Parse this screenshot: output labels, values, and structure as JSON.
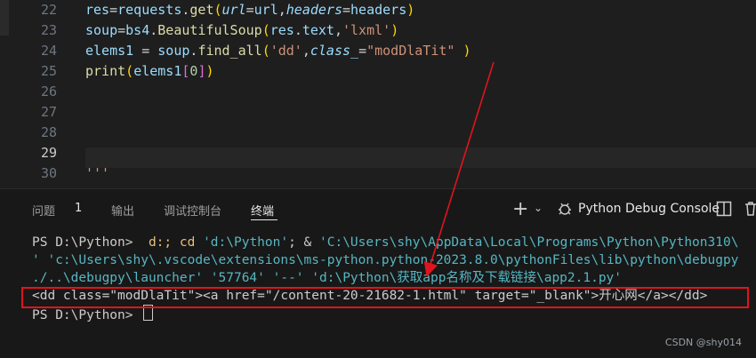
{
  "editor": {
    "lines": [
      {
        "num": "22",
        "tokens": [
          [
            "v",
            "res"
          ],
          [
            "p",
            "="
          ],
          [
            "v",
            "requests"
          ],
          [
            "p",
            "."
          ],
          [
            "f",
            "get"
          ],
          [
            "y",
            "("
          ],
          [
            "i",
            "url"
          ],
          [
            "p",
            "="
          ],
          [
            "v",
            "url"
          ],
          [
            "p",
            ","
          ],
          [
            "i",
            "headers"
          ],
          [
            "p",
            "="
          ],
          [
            "v",
            "headers"
          ],
          [
            "y",
            ")"
          ]
        ]
      },
      {
        "num": "23",
        "tokens": [
          [
            "v",
            "soup"
          ],
          [
            "p",
            "="
          ],
          [
            "v",
            "bs4"
          ],
          [
            "p",
            "."
          ],
          [
            "f",
            "BeautifulSoup"
          ],
          [
            "y",
            "("
          ],
          [
            "v",
            "res"
          ],
          [
            "p",
            "."
          ],
          [
            "v",
            "text"
          ],
          [
            "p",
            ","
          ],
          [
            "s",
            "'lxml'"
          ],
          [
            "y",
            ")"
          ]
        ]
      },
      {
        "num": "24",
        "tokens": [
          [
            "v",
            "elems1"
          ],
          [
            "p",
            " = "
          ],
          [
            "v",
            "soup"
          ],
          [
            "p",
            "."
          ],
          [
            "f",
            "find_all"
          ],
          [
            "y",
            "("
          ],
          [
            "s",
            "'dd'"
          ],
          [
            "p",
            ","
          ],
          [
            "i",
            "class_"
          ],
          [
            "p",
            "="
          ],
          [
            "s",
            "\"modDlaTit\""
          ],
          [
            "p",
            " "
          ],
          [
            "y",
            ")"
          ]
        ]
      },
      {
        "num": "25",
        "tokens": [
          [
            "f",
            "print"
          ],
          [
            "y",
            "("
          ],
          [
            "v",
            "elems1"
          ],
          [
            "m",
            "["
          ],
          [
            "n",
            "0"
          ],
          [
            "m",
            "]"
          ],
          [
            "y",
            ")"
          ]
        ]
      },
      {
        "num": "26",
        "tokens": []
      },
      {
        "num": "27",
        "tokens": []
      },
      {
        "num": "28",
        "tokens": []
      },
      {
        "num": "29",
        "tokens": []
      },
      {
        "num": "30",
        "tokens": [
          [
            "s",
            "'''"
          ]
        ]
      }
    ],
    "active_line": "29"
  },
  "panel": {
    "tabs": [
      {
        "label": "问题",
        "active": false
      },
      {
        "label": "输出",
        "active": false
      },
      {
        "label": "调试控制台",
        "active": false
      },
      {
        "label": "终端",
        "active": true
      }
    ],
    "problems_count": "1",
    "console_name": "Python Debug Console",
    "toolbar_icons": [
      "plus-icon",
      "chevron-down-icon",
      "bug-icon",
      "split-icon",
      "trash-icon"
    ]
  },
  "terminal": {
    "line1_prompt": "PS D:\\Python>  ",
    "line1_cmd": "d:; cd ",
    "line1_path": "'d:\\Python'",
    "line1_amp": "; & ",
    "line1_exe": "'C:\\Users\\shy\\AppData\\Local\\Programs\\Python\\Python310\\",
    "line2": "' 'c:\\Users\\shy\\.vscode\\extensions\\ms-python.python-2023.8.0\\pythonFiles\\lib\\python\\debugpy",
    "line3": "./..\\debugpy\\launcher' '57764' '--' 'd:\\Python\\获取app名称及下载链接\\app2.1.py'",
    "line4": "<dd class=\"modDlaTit\"><a href=\"/content-20-21682-1.html\" target=\"_blank\">开心网</a></dd>",
    "line5_prompt": "PS D:\\Python> "
  },
  "watermark": "CSDN @shy014",
  "colors": {
    "annotation": "#e0141e"
  }
}
